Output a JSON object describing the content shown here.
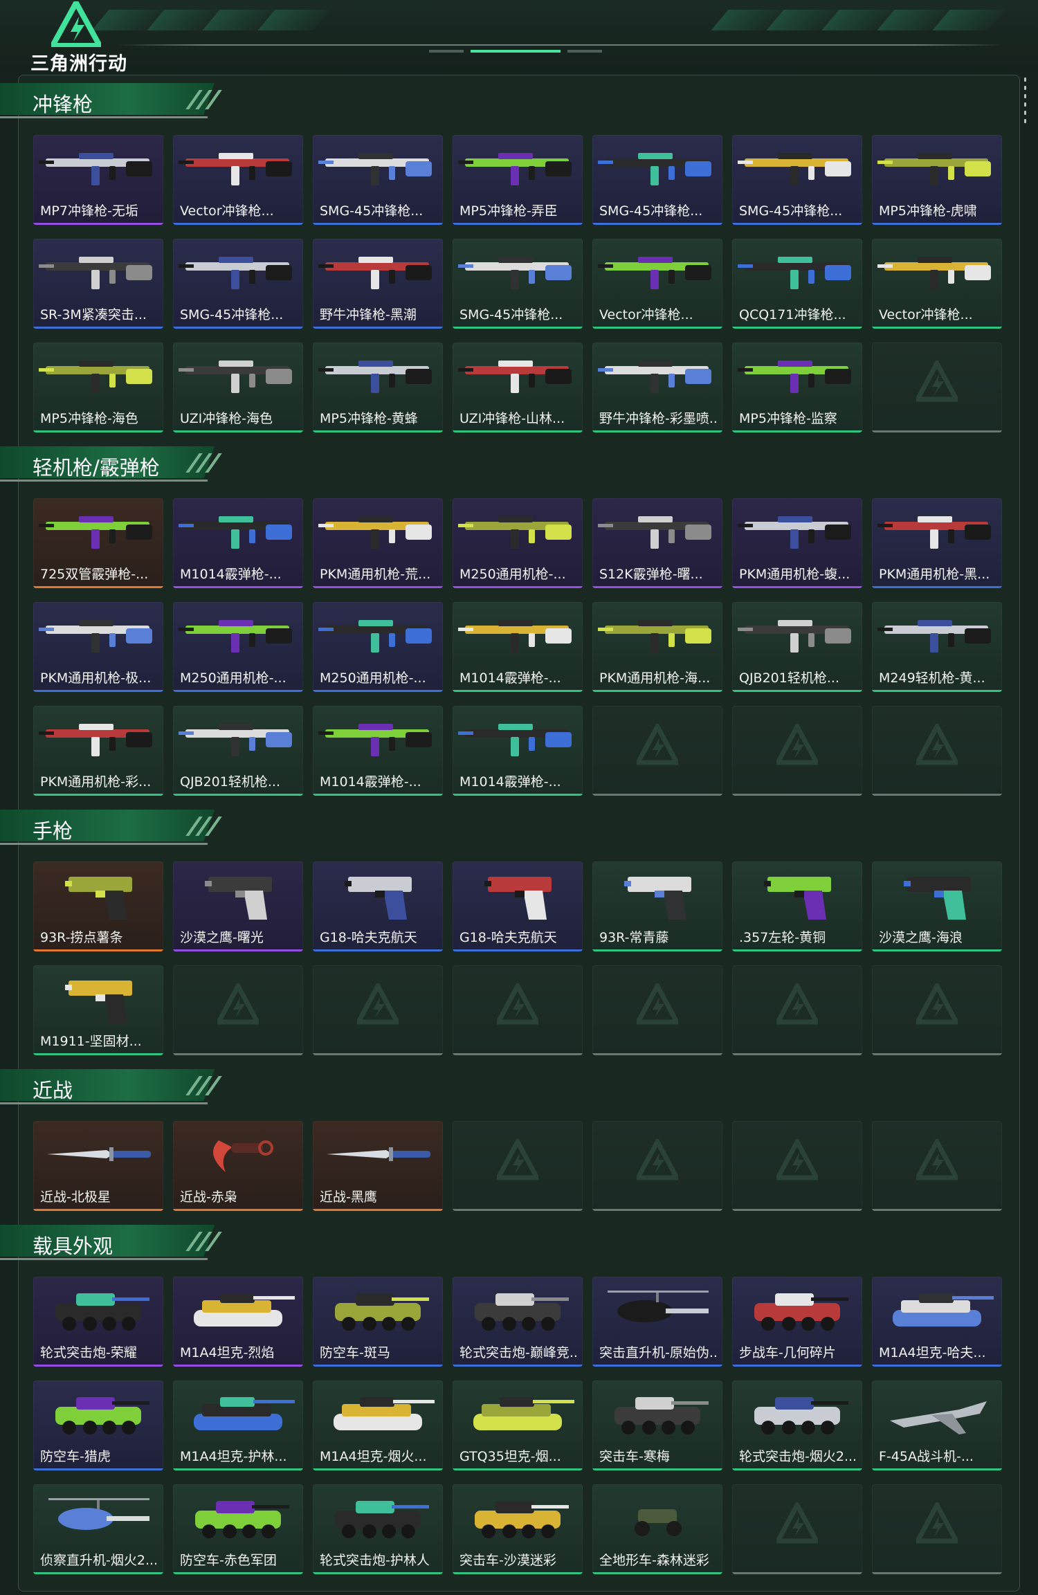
{
  "header": {
    "logo_text": "三角洲行动"
  },
  "sections": [
    {
      "title": "冲锋枪",
      "items": [
        {
          "name": "MP7冲锋枪-无垢",
          "rarity": "purple",
          "kind": "gun"
        },
        {
          "name": "Vector冲锋枪...",
          "rarity": "blue",
          "kind": "gun"
        },
        {
          "name": "SMG-45冲锋枪...",
          "rarity": "blue",
          "kind": "gun"
        },
        {
          "name": "MP5冲锋枪-弄臣",
          "rarity": "blue",
          "kind": "gun"
        },
        {
          "name": "SMG-45冲锋枪...",
          "rarity": "blue",
          "kind": "gun"
        },
        {
          "name": "SMG-45冲锋枪...",
          "rarity": "blue",
          "kind": "gun"
        },
        {
          "name": "MP5冲锋枪-虎啸",
          "rarity": "blue",
          "kind": "gun"
        },
        {
          "name": "SR-3M紧凑突击...",
          "rarity": "blue",
          "kind": "gun"
        },
        {
          "name": "SMG-45冲锋枪...",
          "rarity": "blue",
          "kind": "gun"
        },
        {
          "name": "野牛冲锋枪-黑潮",
          "rarity": "blue",
          "kind": "gun"
        },
        {
          "name": "SMG-45冲锋枪...",
          "rarity": "green",
          "kind": "gun"
        },
        {
          "name": "Vector冲锋枪...",
          "rarity": "green",
          "kind": "gun"
        },
        {
          "name": "QCQ171冲锋枪...",
          "rarity": "green",
          "kind": "gun"
        },
        {
          "name": "Vector冲锋枪...",
          "rarity": "green",
          "kind": "gun"
        },
        {
          "name": "MP5冲锋枪-海色",
          "rarity": "green",
          "kind": "gun"
        },
        {
          "name": "UZI冲锋枪-海色",
          "rarity": "green",
          "kind": "gun"
        },
        {
          "name": "MP5冲锋枪-黄蜂",
          "rarity": "green",
          "kind": "gun"
        },
        {
          "name": "UZI冲锋枪-山林...",
          "rarity": "green",
          "kind": "gun"
        },
        {
          "name": "野牛冲锋枪-彩墨喷...",
          "rarity": "green",
          "kind": "gun"
        },
        {
          "name": "MP5冲锋枪-监察",
          "rarity": "green",
          "kind": "gun"
        },
        {
          "name": "",
          "rarity": "empty",
          "kind": "empty"
        }
      ]
    },
    {
      "title": "轻机枪/霰弹枪",
      "items": [
        {
          "name": "725双管霰弹枪-...",
          "rarity": "orange",
          "kind": "gun"
        },
        {
          "name": "M1014霰弹枪-...",
          "rarity": "purple",
          "kind": "gun"
        },
        {
          "name": "PKM通用机枪-荒...",
          "rarity": "purple",
          "kind": "gun"
        },
        {
          "name": "M250通用机枪-...",
          "rarity": "purple",
          "kind": "gun"
        },
        {
          "name": "S12K霰弹枪-曙...",
          "rarity": "purple",
          "kind": "gun"
        },
        {
          "name": "PKM通用机枪-蝮...",
          "rarity": "purple",
          "kind": "gun"
        },
        {
          "name": "PKM通用机枪-黑...",
          "rarity": "blue",
          "kind": "gun"
        },
        {
          "name": "PKM通用机枪-极...",
          "rarity": "blue",
          "kind": "gun"
        },
        {
          "name": "M250通用机枪-...",
          "rarity": "blue",
          "kind": "gun"
        },
        {
          "name": "M250通用机枪-...",
          "rarity": "blue",
          "kind": "gun"
        },
        {
          "name": "M1014霰弹枪-...",
          "rarity": "green",
          "kind": "gun"
        },
        {
          "name": "PKM通用机枪-海...",
          "rarity": "green",
          "kind": "gun"
        },
        {
          "name": "QJB201轻机枪...",
          "rarity": "green",
          "kind": "gun"
        },
        {
          "name": "M249轻机枪-黄...",
          "rarity": "green",
          "kind": "gun"
        },
        {
          "name": "PKM通用机枪-彩...",
          "rarity": "green",
          "kind": "gun"
        },
        {
          "name": "QJB201轻机枪...",
          "rarity": "green",
          "kind": "gun"
        },
        {
          "name": "M1014霰弹枪-...",
          "rarity": "green",
          "kind": "gun"
        },
        {
          "name": "M1014霰弹枪-...",
          "rarity": "green",
          "kind": "gun"
        },
        {
          "name": "",
          "rarity": "empty",
          "kind": "empty"
        },
        {
          "name": "",
          "rarity": "empty",
          "kind": "empty"
        },
        {
          "name": "",
          "rarity": "empty",
          "kind": "empty"
        }
      ]
    },
    {
      "title": "手枪",
      "items": [
        {
          "name": "93R-捞点薯条",
          "rarity": "orange",
          "kind": "pistol"
        },
        {
          "name": "沙漠之鹰-曙光",
          "rarity": "purple",
          "kind": "pistol"
        },
        {
          "name": "G18-哈夫克航天",
          "rarity": "blue",
          "kind": "pistol"
        },
        {
          "name": "G18-哈夫克航天",
          "rarity": "blue",
          "kind": "pistol"
        },
        {
          "name": "93R-常青藤",
          "rarity": "green",
          "kind": "pistol"
        },
        {
          "name": ".357左轮-黄铜",
          "rarity": "green",
          "kind": "pistol"
        },
        {
          "name": "沙漠之鹰-海浪",
          "rarity": "green",
          "kind": "pistol"
        },
        {
          "name": "M1911-坚固材...",
          "rarity": "green",
          "kind": "pistol"
        },
        {
          "name": "",
          "rarity": "empty",
          "kind": "empty"
        },
        {
          "name": "",
          "rarity": "empty",
          "kind": "empty"
        },
        {
          "name": "",
          "rarity": "empty",
          "kind": "empty"
        },
        {
          "name": "",
          "rarity": "empty",
          "kind": "empty"
        },
        {
          "name": "",
          "rarity": "empty",
          "kind": "empty"
        },
        {
          "name": "",
          "rarity": "empty",
          "kind": "empty"
        }
      ]
    },
    {
      "title": "近战",
      "items": [
        {
          "name": "近战-北极星",
          "rarity": "orange",
          "kind": "knife"
        },
        {
          "name": "近战-赤枭",
          "rarity": "orange",
          "kind": "karambit"
        },
        {
          "name": "近战-黑鹰",
          "rarity": "orange",
          "kind": "knife"
        },
        {
          "name": "",
          "rarity": "empty",
          "kind": "empty"
        },
        {
          "name": "",
          "rarity": "empty",
          "kind": "empty"
        },
        {
          "name": "",
          "rarity": "empty",
          "kind": "empty"
        },
        {
          "name": "",
          "rarity": "empty",
          "kind": "empty"
        }
      ]
    },
    {
      "title": "载具外观",
      "items": [
        {
          "name": "轮式突击炮-荣耀",
          "rarity": "purple",
          "kind": "vehicle"
        },
        {
          "name": "M1A4坦克-烈焰",
          "rarity": "purple",
          "kind": "tank"
        },
        {
          "name": "防空车-斑马",
          "rarity": "blue",
          "kind": "vehicle"
        },
        {
          "name": "轮式突击炮-巅峰竞...",
          "rarity": "blue",
          "kind": "vehicle"
        },
        {
          "name": "突击直升机-原始伪...",
          "rarity": "blue",
          "kind": "heli"
        },
        {
          "name": "步战车-几何碎片",
          "rarity": "blue",
          "kind": "vehicle"
        },
        {
          "name": "M1A4坦克-哈夫...",
          "rarity": "blue",
          "kind": "tank"
        },
        {
          "name": "防空车-猎虎",
          "rarity": "blue",
          "kind": "vehicle"
        },
        {
          "name": "M1A4坦克-护林...",
          "rarity": "green",
          "kind": "tank"
        },
        {
          "name": "M1A4坦克-烟火...",
          "rarity": "green",
          "kind": "tank"
        },
        {
          "name": "GTQ35坦克-烟...",
          "rarity": "green",
          "kind": "tank"
        },
        {
          "name": "突击车-寒梅",
          "rarity": "green",
          "kind": "vehicle"
        },
        {
          "name": "轮式突击炮-烟火2...",
          "rarity": "green",
          "kind": "vehicle"
        },
        {
          "name": "F-45A战斗机-...",
          "rarity": "green",
          "kind": "jet"
        },
        {
          "name": "侦察直升机-烟火2...",
          "rarity": "green",
          "kind": "heli"
        },
        {
          "name": "防空车-赤色军团",
          "rarity": "green",
          "kind": "vehicle"
        },
        {
          "name": "轮式突击炮-护林人",
          "rarity": "green",
          "kind": "vehicle"
        },
        {
          "name": "突击车-沙漠迷彩",
          "rarity": "green",
          "kind": "vehicle"
        },
        {
          "name": "全地形车-森林迷彩",
          "rarity": "green",
          "kind": "atv"
        },
        {
          "name": "",
          "rarity": "empty",
          "kind": "empty"
        },
        {
          "name": "",
          "rarity": "empty",
          "kind": "empty"
        }
      ]
    }
  ]
}
